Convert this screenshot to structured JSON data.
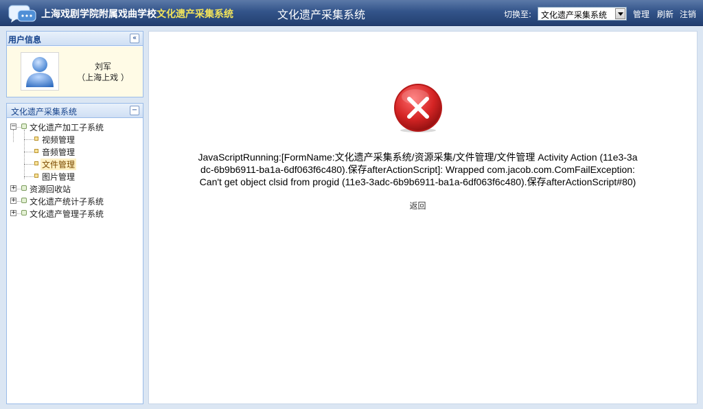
{
  "header": {
    "logo_icon": "chat-bubbles-icon",
    "brand_prefix": "上海戏剧学院附属戏曲学校",
    "brand_highlight": "文化遗产采集系统",
    "center_title": "文化遗产采集系统",
    "switch_label": "切换至:",
    "system_select_value": "文化遗产采集系统",
    "links": {
      "manage": "管理",
      "refresh": "刷新",
      "logout": "注销"
    },
    "colors": {
      "bar_top": "#5b79a8",
      "bar_bottom": "#233f70",
      "highlight": "#f2e35a"
    }
  },
  "user_panel": {
    "title": "用户信息",
    "collapse_icon": "double-chevron-left-icon",
    "avatar_icon": "user-avatar-icon",
    "name": "刘军",
    "org": "（上海上戏 ）"
  },
  "tree_panel": {
    "title": "文化遗产采集系统",
    "collapse_icon": "minus-icon",
    "root": {
      "label": "文化遗产加工子系统",
      "expanded": true
    },
    "children": [
      {
        "label": "视频管理",
        "selected": false
      },
      {
        "label": "音频管理",
        "selected": false
      },
      {
        "label": "文件管理",
        "selected": true
      },
      {
        "label": "图片管理",
        "selected": false
      }
    ],
    "others": [
      {
        "label": "资源回收站"
      },
      {
        "label": "文化遗产统计子系统"
      },
      {
        "label": "文化遗产管理子系统"
      }
    ]
  },
  "main": {
    "error_icon": "error-x-icon",
    "error_message": "JavaScriptRunning:[FormName:文化遗产采集系统/资源采集/文件管理/文件管理  Activity Action (11e3-3adc-6b9b6911-ba1a-6df063f6c480).保存afterActionScript]: Wrapped com.jacob.com.ComFailException: Can't get object clsid from progid (11e3-3adc-6b9b6911-ba1a-6df063f6c480).保存afterActionScript#80)",
    "back_label": "返回",
    "colors": {
      "error_red": "#d42424"
    }
  }
}
